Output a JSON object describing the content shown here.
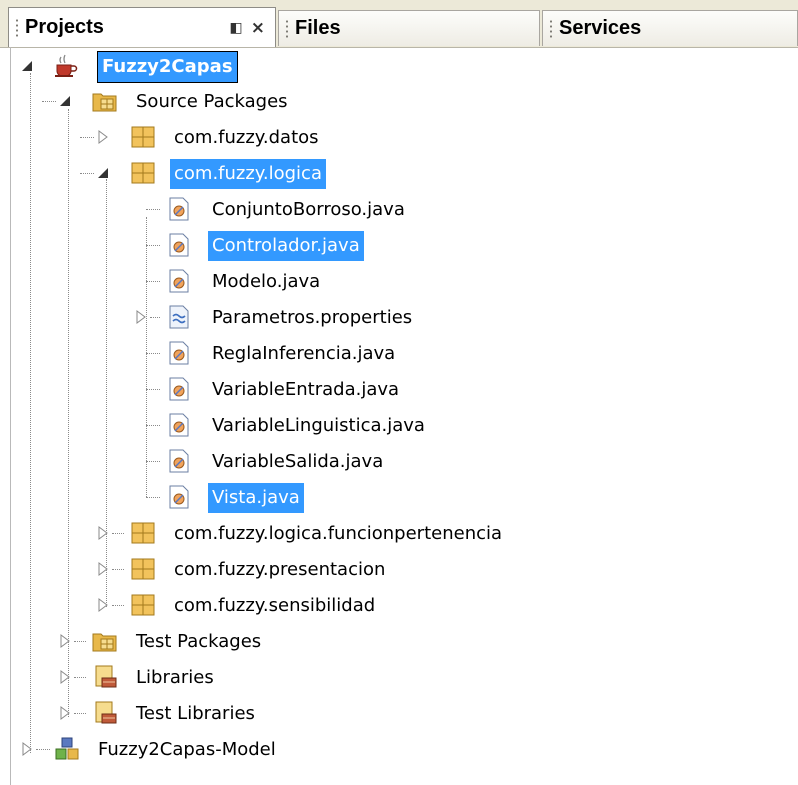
{
  "tabs": [
    {
      "label": "Projects",
      "active": true
    },
    {
      "label": "Files",
      "active": false
    },
    {
      "label": "Services",
      "active": false
    }
  ],
  "tab_buttons": {
    "minimize": "◧",
    "close": "×"
  },
  "tree": {
    "root": {
      "label": "Fuzzy2Capas",
      "icon": "java-project-icon"
    },
    "source_packages": {
      "label": "Source Packages",
      "icon": "source-folder-icon"
    },
    "packages": [
      {
        "label": "com.fuzzy.datos",
        "expanded": false
      },
      {
        "label": "com.fuzzy.logica",
        "expanded": true
      },
      {
        "label": "com.fuzzy.logica.funcionpertenencia",
        "expanded": false
      },
      {
        "label": "com.fuzzy.presentacion",
        "expanded": false
      },
      {
        "label": "com.fuzzy.sensibilidad",
        "expanded": false
      }
    ],
    "files": [
      {
        "label": "ConjuntoBorroso.java",
        "icon": "java-class-icon"
      },
      {
        "label": "Controlador.java",
        "icon": "java-class-icon",
        "selected": true
      },
      {
        "label": "Modelo.java",
        "icon": "java-class-icon"
      },
      {
        "label": "Parametros.properties",
        "icon": "properties-file-icon"
      },
      {
        "label": "ReglaInferencia.java",
        "icon": "java-class-icon"
      },
      {
        "label": "VariableEntrada.java",
        "icon": "java-class-icon"
      },
      {
        "label": "VariableLinguistica.java",
        "icon": "java-class-icon"
      },
      {
        "label": "VariableSalida.java",
        "icon": "java-class-icon"
      },
      {
        "label": "Vista.java",
        "icon": "java-class-icon",
        "selected": true
      }
    ],
    "test_packages": {
      "label": "Test Packages"
    },
    "libraries": {
      "label": "Libraries"
    },
    "test_libraries": {
      "label": "Test Libraries"
    },
    "other_project": {
      "label": "Fuzzy2Capas-Model"
    }
  },
  "colors": {
    "selection": "#3399ff",
    "tab_bg": "#ece9d8",
    "package_icon": "#e8b84a"
  }
}
